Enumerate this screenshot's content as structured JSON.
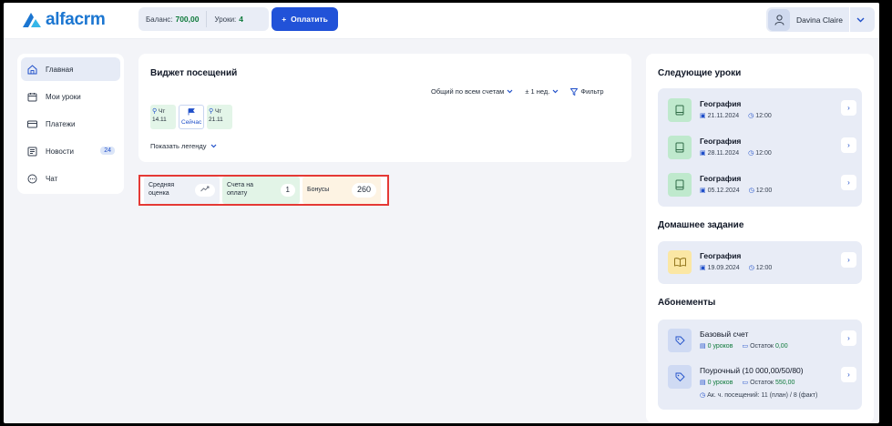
{
  "header": {
    "logo_text": "alfacrm",
    "balance_label": "Баланс:",
    "balance_value": "700,00",
    "lessons_label": "Уроки:",
    "lessons_value": "4",
    "pay_button": "Оплатить",
    "pay_icon": "plus-icon",
    "user_name": "Davina Claire"
  },
  "sidebar": {
    "items": [
      {
        "label": "Главная",
        "icon": "home-icon",
        "active": true
      },
      {
        "label": "Мои уроки",
        "icon": "calendar-icon"
      },
      {
        "label": "Платежи",
        "icon": "card-icon"
      },
      {
        "label": "Новости",
        "icon": "news-icon",
        "badge": "24"
      },
      {
        "label": "Чат",
        "icon": "chat-icon"
      }
    ]
  },
  "widget": {
    "title": "Виджет посещений",
    "filter_accounts": "Общий по всем счетам",
    "filter_period": "± 1 нед.",
    "filter_button": "Фильтр",
    "days": [
      {
        "dow": "Чт",
        "date": "14.11"
      },
      {
        "label": "Сейчас"
      },
      {
        "dow": "Чт",
        "date": "21.11"
      }
    ],
    "legend_toggle": "Показать легенду"
  },
  "stats": {
    "avg_label_1": "Средняя",
    "avg_label_2": "оценка",
    "invoices_label_1": "Счета на",
    "invoices_label_2": "оплату",
    "invoices_value": "1",
    "bonus_label": "Бонусы",
    "bonus_value": "260"
  },
  "right": {
    "next_lessons_title": "Следующие уроки",
    "next_lessons": [
      {
        "subject": "География",
        "date": "21.11.2024",
        "time": "12:00"
      },
      {
        "subject": "География",
        "date": "28.11.2024",
        "time": "12:00"
      },
      {
        "subject": "География",
        "date": "05.12.2024",
        "time": "12:00"
      }
    ],
    "homework_title": "Домашнее задание",
    "homework": {
      "subject": "География",
      "date": "19.09.2024",
      "time": "12:00"
    },
    "subs_title": "Абонементы",
    "subscriptions": [
      {
        "name": "Базовый счет",
        "lessons": "0 уроков",
        "remainder_label": "Остаток",
        "remainder_value": "0,00"
      },
      {
        "name": "Поурочный (10 000,00/50/80)",
        "lessons": "0 уроков",
        "remainder_label": "Остаток",
        "remainder_value": "550,00",
        "visits": "Ак. ч. посещений: 11 (план) / 8 (факт)"
      }
    ]
  }
}
